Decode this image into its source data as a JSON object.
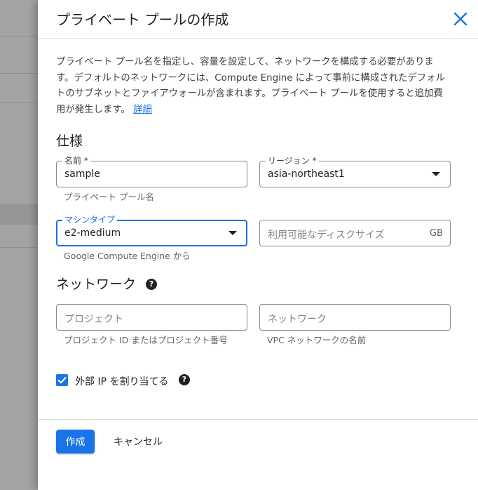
{
  "dialog": {
    "title": "プライベート プールの作成",
    "description": "プライベート プール名を指定し、容量を設定して、ネットワークを構成する必要があります。デフォルトのネットワークには、Compute Engine によって事前に構成されたデフォルトのサブネットとファイアウォールが含まれます。プライベート プールを使用すると追加費用が発生します。",
    "learn_more": "詳細"
  },
  "spec": {
    "heading": "仕様",
    "name": {
      "label": "名前 *",
      "value": "sample",
      "hint": "プライベート プール名"
    },
    "region": {
      "label": "リージョン *",
      "value": "asia-northeast1"
    },
    "machine_type": {
      "label": "マシンタイプ",
      "value": "e2-medium",
      "hint": "Google Compute Engine から"
    },
    "disk_size": {
      "placeholder": "利用可能なディスクサイズ",
      "unit": "GB"
    }
  },
  "network": {
    "heading": "ネットワーク",
    "project": {
      "placeholder": "プロジェクト",
      "hint": "プロジェクト ID またはプロジェクト番号"
    },
    "network": {
      "placeholder": "ネットワーク",
      "hint": "VPC ネットワークの名前"
    },
    "external_ip": {
      "label": "外部 IP を割り当てる",
      "checked": true
    }
  },
  "footer": {
    "create_label": "作成",
    "cancel_label": "キャンセル"
  },
  "colors": {
    "accent": "#1a73e8",
    "text": "#202124",
    "muted": "#5f6368",
    "border": "#8a8a8a"
  }
}
